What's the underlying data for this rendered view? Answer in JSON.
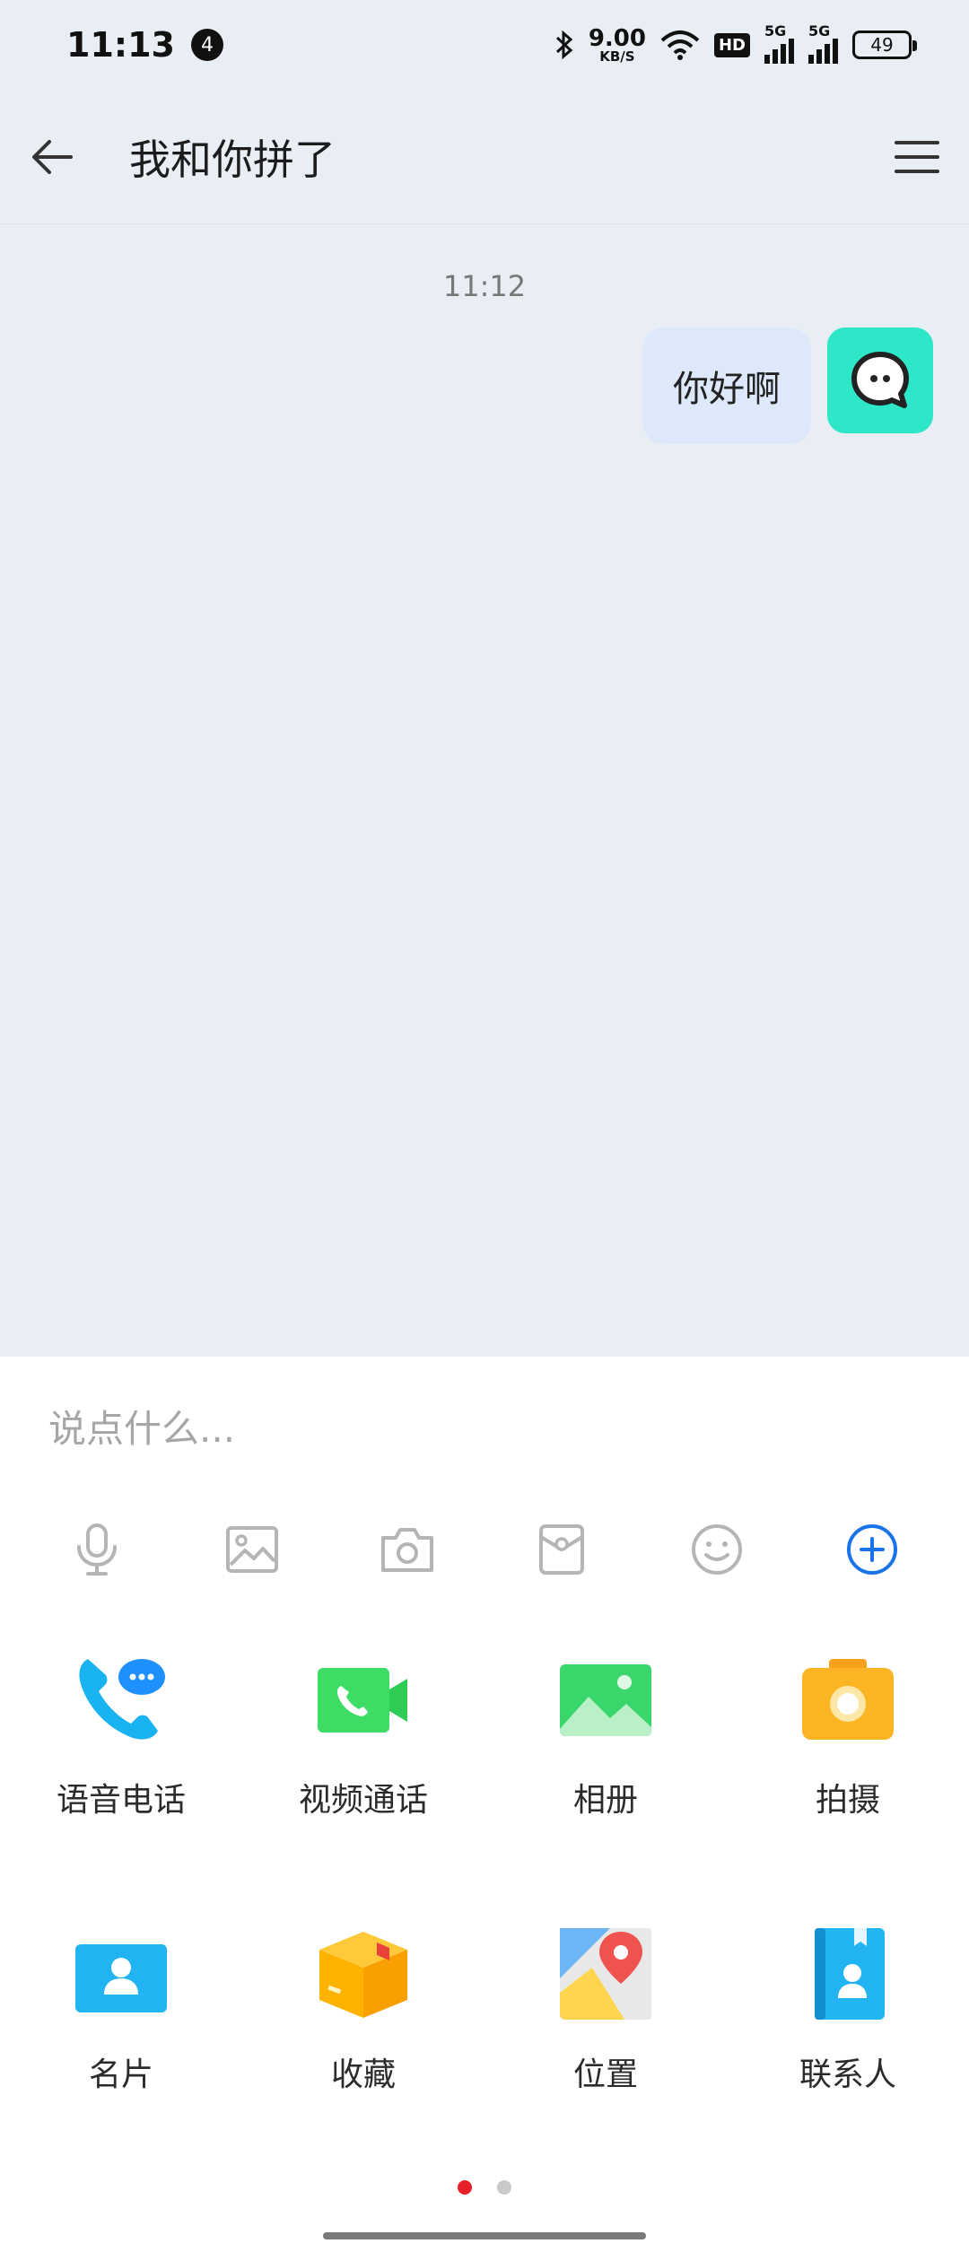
{
  "status_bar": {
    "time": "11:13",
    "notification_count": "4",
    "net_speed_value": "9.00",
    "net_speed_unit": "KB/S",
    "hd_label": "HD",
    "signal1_label": "5G",
    "signal2_label": "5G",
    "battery": "49"
  },
  "header": {
    "title": "我和你拼了",
    "back_icon": "arrow-left-icon",
    "menu_icon": "hamburger-menu-icon"
  },
  "chat": {
    "timestamp": "11:12",
    "messages": [
      {
        "text": "你好啊",
        "sender": "self"
      }
    ]
  },
  "composer": {
    "placeholder": "说点什么...",
    "value": "",
    "toolbar_icons": [
      "microphone-icon",
      "image-icon",
      "camera-icon",
      "gift-icon",
      "emoji-icon",
      "plus-circle-icon"
    ],
    "accent_color": "#1a73e8"
  },
  "actions": [
    {
      "label": "语音电话",
      "icon": "voice-call-icon"
    },
    {
      "label": "视频通话",
      "icon": "video-call-icon"
    },
    {
      "label": "相册",
      "icon": "album-icon"
    },
    {
      "label": "拍摄",
      "icon": "shoot-camera-icon"
    },
    {
      "label": "名片",
      "icon": "business-card-icon"
    },
    {
      "label": "收藏",
      "icon": "favorites-box-icon"
    },
    {
      "label": "位置",
      "icon": "location-map-icon"
    },
    {
      "label": "联系人",
      "icon": "contacts-book-icon"
    }
  ],
  "pager": {
    "pages": 2,
    "active_page": 1
  }
}
